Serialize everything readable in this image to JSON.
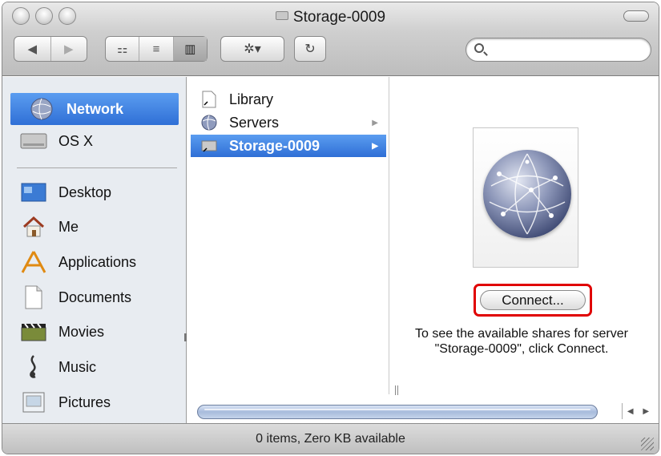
{
  "window": {
    "title": "Storage-0009"
  },
  "toolbar": {
    "nav_back": "◀",
    "nav_forward": "▶",
    "view_icon": "⚏",
    "view_list": "≡",
    "view_column": "▥",
    "action_label": "✲▾",
    "refresh": "↻",
    "search_placeholder": ""
  },
  "sidebar": {
    "items": [
      {
        "label": "Network",
        "icon": "network-globe-icon",
        "selected": true
      },
      {
        "label": "OS X",
        "icon": "hard-drive-icon"
      },
      {
        "label": "Desktop",
        "icon": "desktop-icon"
      },
      {
        "label": "Me",
        "icon": "home-icon"
      },
      {
        "label": "Applications",
        "icon": "applications-icon"
      },
      {
        "label": "Documents",
        "icon": "documents-icon"
      },
      {
        "label": "Movies",
        "icon": "movies-icon"
      },
      {
        "label": "Music",
        "icon": "music-icon"
      },
      {
        "label": "Pictures",
        "icon": "pictures-icon"
      }
    ]
  },
  "column": {
    "items": [
      {
        "label": "Library",
        "icon": "alias-doc-icon"
      },
      {
        "label": "Servers",
        "icon": "servers-icon",
        "has_children": true
      },
      {
        "label": "Storage-0009",
        "icon": "server-alias-icon",
        "has_children": true,
        "selected": true
      }
    ]
  },
  "preview": {
    "connect_label": "Connect...",
    "info_text": "To see the available shares for server \"Storage-0009\", click Connect."
  },
  "status": {
    "text": "0 items, Zero KB available"
  },
  "colors": {
    "selection": "#3a7be0",
    "highlight_box": "#e00000"
  }
}
